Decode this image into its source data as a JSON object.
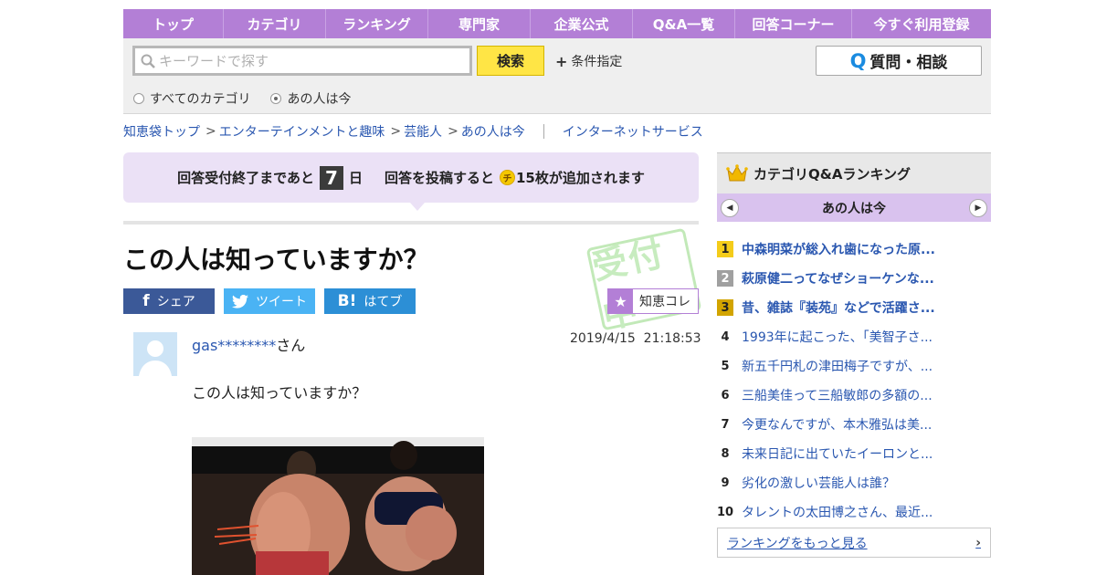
{
  "nav": [
    "トップ",
    "カテゴリ",
    "ランキング",
    "専門家",
    "企業公式",
    "Q&A一覧",
    "回答コーナー",
    "今すぐ利用登録"
  ],
  "search": {
    "placeholder": "キーワードで探す",
    "button": "検索",
    "condition": "条件指定",
    "ask_button": "質問・相談",
    "ask_q": "Q",
    "scope_all": "すべてのカテゴリ",
    "scope_current": "あの人は今",
    "selected_scope": "あの人は今"
  },
  "breadcrumb": {
    "items": [
      "知恵袋トップ",
      "エンターテインメントと趣味",
      "芸能人",
      "あの人は今"
    ],
    "separator": ">",
    "extra": "インターネットサービス"
  },
  "notice": {
    "prefix": "回答受付終了まであと",
    "days": "7",
    "day_unit": "日",
    "middle": "回答を投稿すると",
    "coin_label": "チ",
    "suffix": "15枚が追加されます"
  },
  "question": {
    "title": "この人は知っていますか？",
    "stamp_text": "受付中",
    "username": "gas********",
    "honorific": "さん",
    "datetime": "2019/4/15  21:18:53",
    "body": "この人は知っていますか？"
  },
  "share": {
    "facebook": "シェア",
    "twitter": "ツイート",
    "hatena": "はてブ",
    "hatena_icon": "B!",
    "chie_kore": "知恵コレ"
  },
  "sidebar": {
    "title": "カテゴリQ&Aランキング",
    "category": "あの人は今",
    "more": "ランキングをもっと見る",
    "ranking": [
      {
        "rank": "1",
        "title": "中森明菜が総入れ歯になった原..."
      },
      {
        "rank": "2",
        "title": "萩原健二ってなぜショーケンな..."
      },
      {
        "rank": "3",
        "title": "昔、雑誌『装苑』などで活躍さ..."
      },
      {
        "rank": "4",
        "title": "1993年に起こった、「美智子さ..."
      },
      {
        "rank": "5",
        "title": "新五千円札の津田梅子ですが、..."
      },
      {
        "rank": "6",
        "title": "三船美佳って三船敏郎の多額の..."
      },
      {
        "rank": "7",
        "title": "今更なんですが、本木雅弘は美..."
      },
      {
        "rank": "8",
        "title": "未来日記に出ていたイーロンと..."
      },
      {
        "rank": "9",
        "title": "劣化の激しい芸能人は誰？"
      },
      {
        "rank": "10",
        "title": "タレントの太田博之さん、最近..."
      }
    ]
  },
  "colors": {
    "nav_bg": "#b37fd6",
    "link": "#2a57b0",
    "search_button": "#ffe545",
    "notice_bg": "#ebe1f6"
  }
}
